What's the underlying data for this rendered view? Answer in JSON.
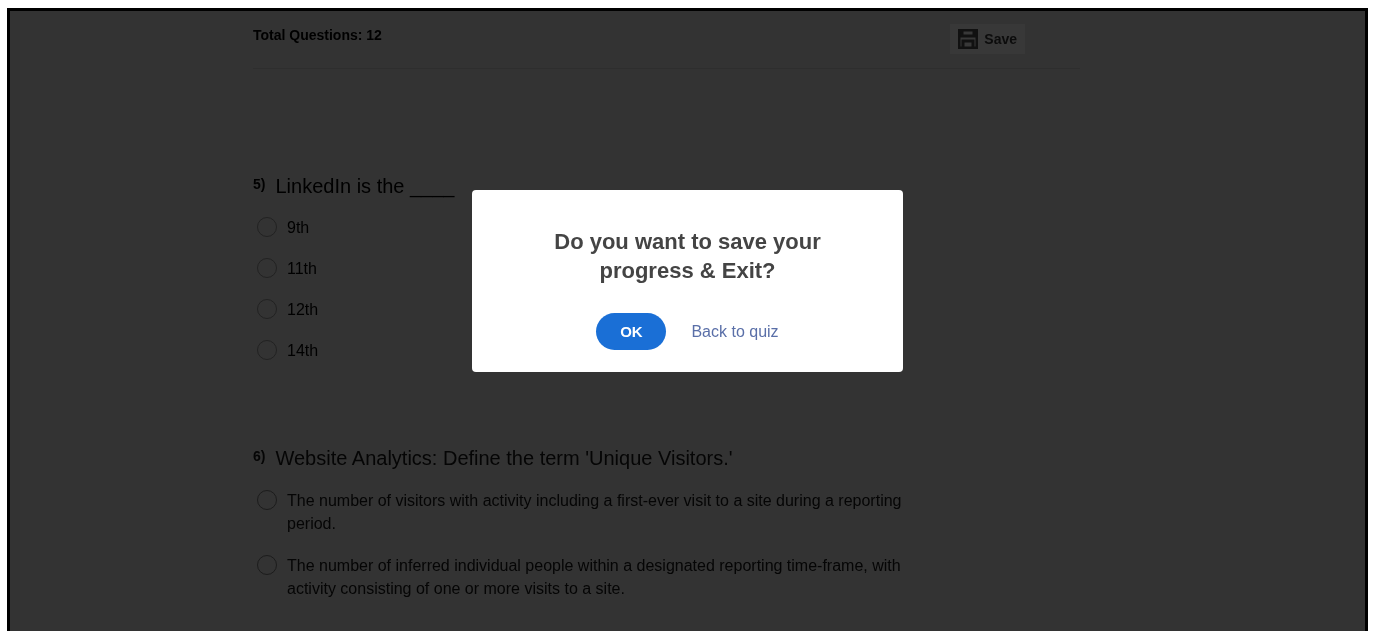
{
  "header": {
    "total_questions": "Total Questions: 12",
    "save_button": "Save"
  },
  "questions": [
    {
      "number": "5)",
      "text": "LinkedIn is the ____",
      "faded": false,
      "options": [
        {
          "label": "9th",
          "selected": false
        },
        {
          "label": "11th",
          "selected": false
        },
        {
          "label": "12th",
          "selected": false
        },
        {
          "label": "14th",
          "selected": false
        }
      ]
    },
    {
      "number": "6)",
      "text": "Website Analytics: Define the term 'Unique Visitors.'",
      "faded": true,
      "options": [
        {
          "label": "The number of visitors with activity including a first-ever visit to a site during a reporting period.",
          "selected": false
        },
        {
          "label": "The number of inferred individual people within a designated reporting time-frame, with activity consisting of one or more visits to a site.",
          "selected": false
        }
      ]
    }
  ],
  "dialog": {
    "message": "Do you want to save your progress & Exit?",
    "ok_button": "OK",
    "back_link": "Back to quiz"
  }
}
